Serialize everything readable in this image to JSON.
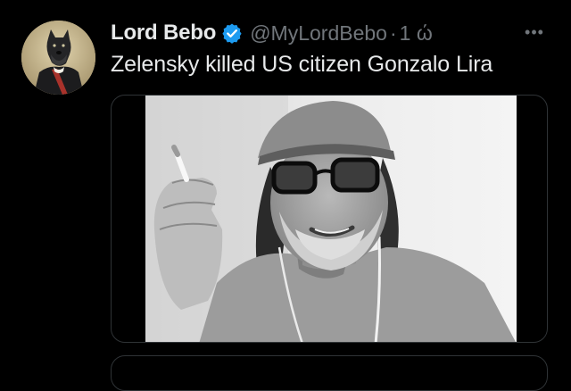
{
  "tweet": {
    "display_name": "Lord Bebo",
    "handle": "@MyLordBebo",
    "separator": "·",
    "time": "1 ώ",
    "more_label": "•••",
    "text": "Zelensky killed US citizen Gonzalo Lira",
    "avatar_icon": "avatar-portrait",
    "verified_icon": "verified-badge-icon",
    "colors": {
      "background": "#000000",
      "primary_text": "#e7e9ea",
      "secondary_text": "#71767b",
      "verified": "#1d9bf0",
      "border": "#2f3336"
    }
  }
}
